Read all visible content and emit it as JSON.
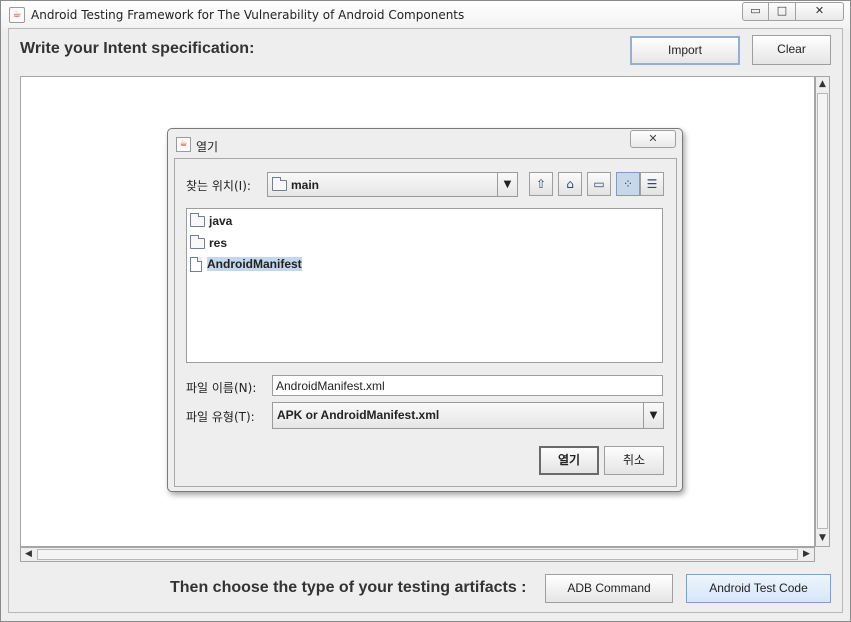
{
  "window": {
    "title": "Android Testing Framework for The Vulnerability of Android Components",
    "minimize_glyph": "▭",
    "maximize_glyph": "□",
    "close_glyph": "✕"
  },
  "header": {
    "label": "Write your Intent specification:",
    "import_button": "Import",
    "clear_button": "Clear"
  },
  "editor": {
    "content": ""
  },
  "footer": {
    "label": "Then choose the type of your testing artifacts :",
    "adb_button": "ADB Command",
    "test_code_button": "Android Test Code"
  },
  "dialog": {
    "title": "열기",
    "close_glyph": "✕",
    "look_in_label": "찾는 위치(I):",
    "look_in_value": "main",
    "toolbar": {
      "up_icon": "up-folder-icon",
      "home_icon": "home-icon",
      "new_folder_icon": "new-folder-icon",
      "list_view_icon": "list-view-icon",
      "details_view_icon": "details-view-icon"
    },
    "files": [
      {
        "name": "java",
        "type": "folder"
      },
      {
        "name": "res",
        "type": "folder"
      },
      {
        "name": "AndroidManifest",
        "type": "file",
        "selected": true
      }
    ],
    "filename_label": "파일 이름(N):",
    "filename_value": "AndroidManifest.xml",
    "filetype_label": "파일 유형(T):",
    "filetype_value": "APK or AndroidManifest.xml",
    "open_button": "열기",
    "cancel_button": "취소"
  },
  "colors": {
    "window_bg": "#eeeeee",
    "selection": "#c4d7ec",
    "focus_border": "#93b0d2"
  }
}
